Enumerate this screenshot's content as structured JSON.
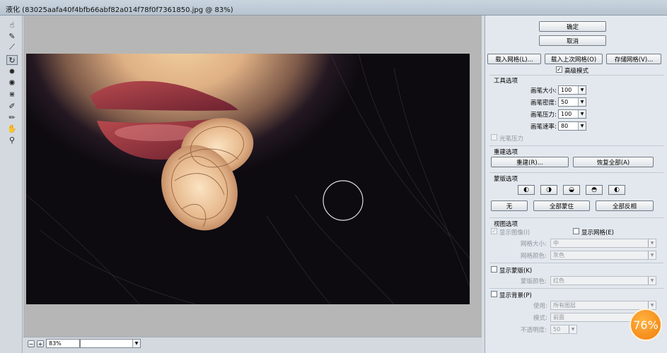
{
  "window": {
    "title": "液化 (83025aafa40f4bfb66abf82a014f78f0f7361850.jpg @ 83%)"
  },
  "tools": [
    "warp",
    "reconstruct",
    "smooth",
    "twirl",
    "pucker",
    "bloat",
    "push",
    "freeze-mask",
    "thaw-mask",
    "hand",
    "zoom"
  ],
  "status": {
    "zoom": "83%"
  },
  "panel": {
    "ok": "确定",
    "cancel": "取消",
    "load_mesh": "载入网格(L)...",
    "load_last_mesh": "载入上次网格(O)",
    "save_mesh": "存储网格(V)...",
    "advanced_mode": "高级模式",
    "tool_options": {
      "title": "工具选项",
      "brush_size_label": "画笔大小:",
      "brush_size": "100",
      "brush_density_label": "画笔密度:",
      "brush_density": "50",
      "brush_pressure_label": "画笔压力:",
      "brush_pressure": "100",
      "brush_rate_label": "画笔速率:",
      "brush_rate": "80",
      "stylus_pressure": "光笔压力"
    },
    "reconstruct": {
      "title": "重建选项",
      "reconstruct_btn": "重建(R)...",
      "restore_all_btn": "恢复全部(A)"
    },
    "mask": {
      "title": "蒙版选项",
      "none_btn": "无",
      "mask_all_btn": "全部蒙住",
      "invert_all_btn": "全部反相"
    },
    "view": {
      "title": "视图选项",
      "show_image": "显示图像(I)",
      "show_mesh": "显示网格(E)",
      "mesh_size_label": "网格大小:",
      "mesh_size": "中",
      "mesh_color_label": "网格颜色:",
      "mesh_color": "灰色",
      "show_mask": "显示蒙版(K)",
      "mask_color_label": "蒙版颜色:",
      "mask_color": "红色",
      "show_backdrop": "显示背景(P)",
      "use_label": "使用:",
      "use": "所有图层",
      "mode_label": "模式:",
      "mode": "前面",
      "opacity_label": "不透明度:",
      "opacity": "50"
    }
  },
  "overlay": {
    "badge": "76%"
  }
}
